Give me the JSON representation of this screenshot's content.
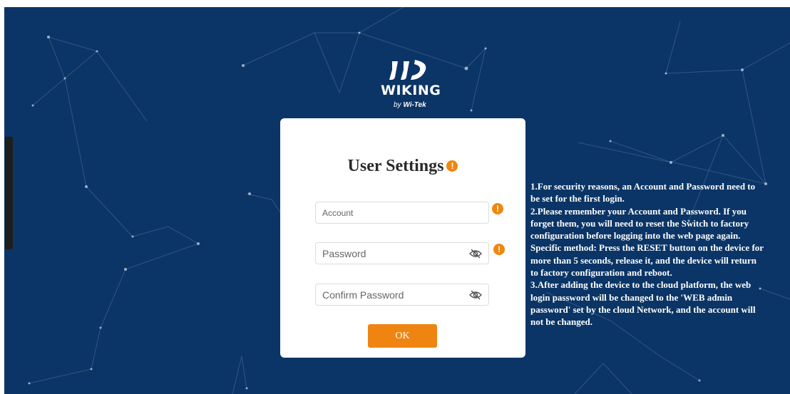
{
  "logo": {
    "wordmark": "WIKING",
    "byline_prefix": "by",
    "byline_brand": "Wi-Tek"
  },
  "card": {
    "title": "User Settings",
    "fields": {
      "account": {
        "placeholder": "Account",
        "value": ""
      },
      "password": {
        "placeholder": "Password",
        "value": ""
      },
      "confirm": {
        "placeholder": "Confirm Password",
        "value": ""
      }
    },
    "ok_label": "OK"
  },
  "info_symbol": "!",
  "notes": [
    "1.For security reasons, an Account and Password need to be set for the first login.",
    "2.Please remember your Account and Password. If you forget them, you will need to reset the Switch to factory configuration before logging into the web page again.",
    "Specific method: Press the RESET button on the device for more than 5 seconds, release it, and the device will return to factory configuration and reboot.",
    "3.After adding the device to the cloud platform, the web login password will be changed to the 'WEB admin password' set by the cloud Network, and the account will not be changed."
  ],
  "colors": {
    "background": "#0b3566",
    "accent": "#ef8411",
    "info": "#f0870e",
    "card": "#ffffff"
  },
  "icons": {
    "info": "info-exclamation-icon",
    "eye": "eye-slash-icon",
    "logo": "wiking-logo-icon"
  }
}
